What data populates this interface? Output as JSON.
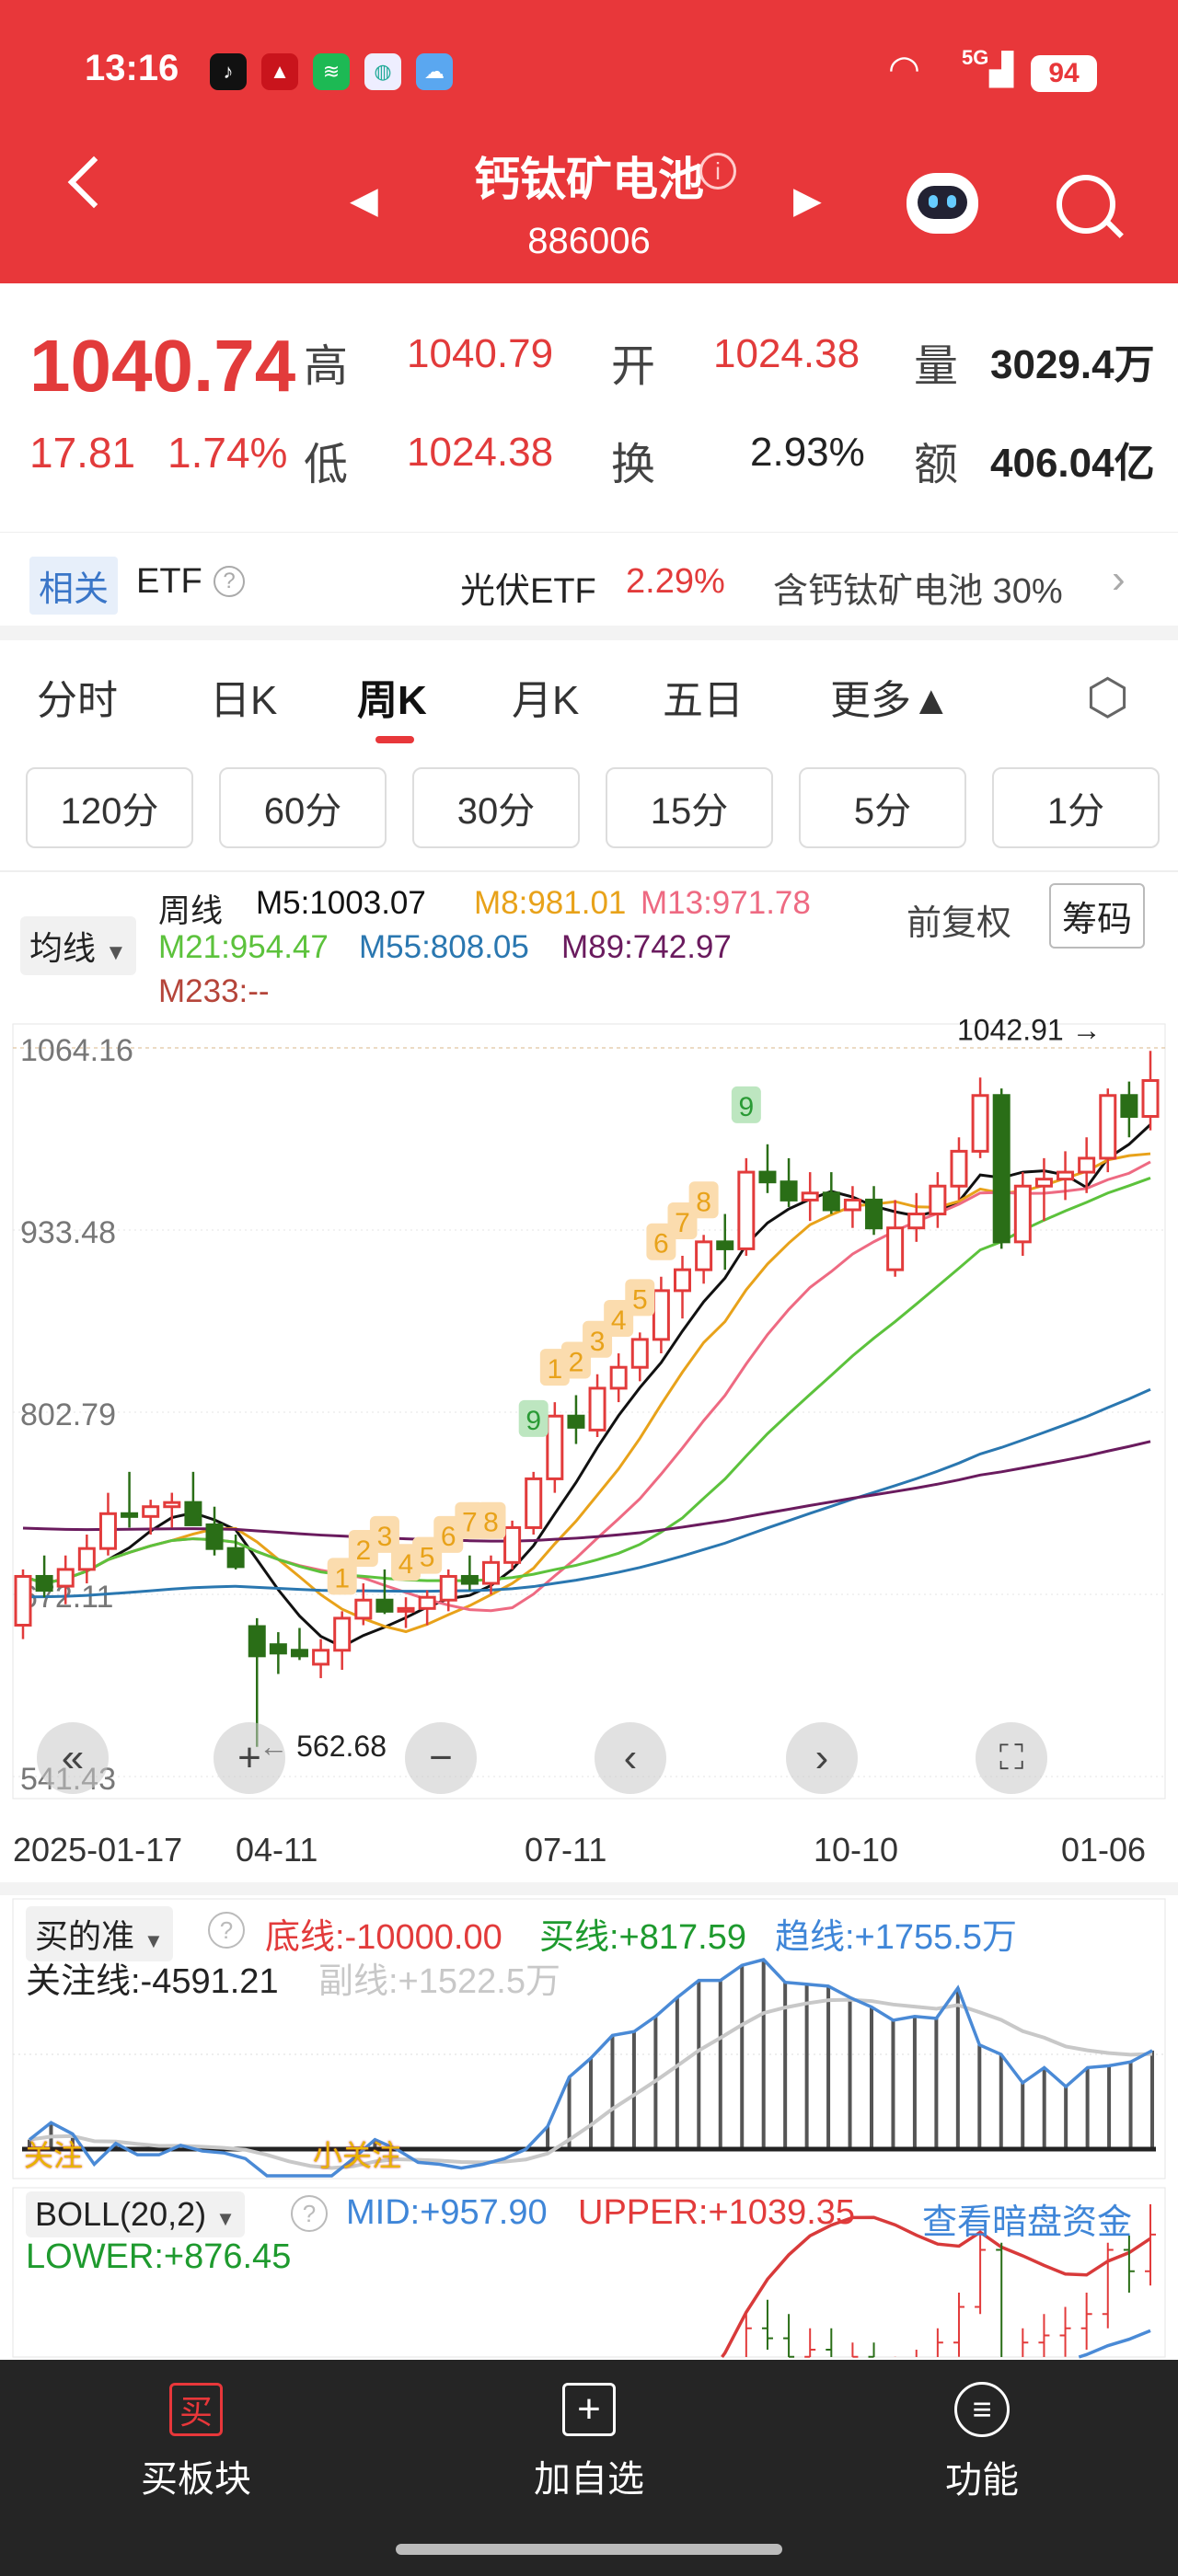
{
  "status_bar": {
    "time": "13:16",
    "network": "5G",
    "battery": "94"
  },
  "header": {
    "title": "钙钛矿电池",
    "code": "886006"
  },
  "quote": {
    "price": "1040.74",
    "change": "17.81",
    "change_pct": "1.74%",
    "high_label": "高",
    "high": "1040.79",
    "open_label": "开",
    "open": "1024.38",
    "volume_label": "量",
    "volume": "3029.4万",
    "low_label": "低",
    "low": "1024.38",
    "turnover_label": "换",
    "turnover": "2.93%",
    "amount_label": "额",
    "amount": "406.04亿"
  },
  "etf_row": {
    "badge": "相关",
    "label": "ETF",
    "etf_name": "光伏ETF",
    "etf_change": "2.29%",
    "holding": "含钙钛矿电池 30%"
  },
  "tabs": [
    {
      "label": "分时"
    },
    {
      "label": "日K"
    },
    {
      "label": "周K",
      "active": true
    },
    {
      "label": "月K"
    },
    {
      "label": "五日"
    },
    {
      "label": "更多▲"
    }
  ],
  "periods": [
    "120分",
    "60分",
    "30分",
    "15分",
    "5分",
    "1分"
  ],
  "legend": {
    "selector": "均线",
    "period": "周线",
    "adjust": "前复权",
    "chips": "筹码",
    "ma": [
      {
        "label": "M5:1003.07",
        "color": "#111111"
      },
      {
        "label": "M8:981.01",
        "color": "#e8a21a"
      },
      {
        "label": "M13:971.78",
        "color": "#ee6a82"
      },
      {
        "label": "M21:954.47",
        "color": "#5cc23c"
      },
      {
        "label": "M55:808.05",
        "color": "#2a77b0"
      },
      {
        "label": "M89:742.97",
        "color": "#6a1b5e"
      },
      {
        "label": "M233:--",
        "color": "#b5453a"
      }
    ]
  },
  "colors": {
    "up": "#e23b3b",
    "down": "#2a6e17",
    "accent": "#e8373a"
  },
  "chart_data": {
    "type": "candlestick",
    "y_ticks": [
      "1064.16",
      "933.48",
      "802.79",
      "672.11",
      "541.43"
    ],
    "y_tick_values": [
      1064.16,
      933.48,
      802.79,
      672.11,
      541.43
    ],
    "ylim": [
      541.43,
      1064.16
    ],
    "x_labels": [
      "2025-01-17",
      "04-11",
      "07-11",
      "10-10",
      "01-06"
    ],
    "max_label": "1042.91",
    "min_label": "562.68",
    "ohlc": [
      [
        650,
        690,
        640,
        685
      ],
      [
        685,
        700,
        670,
        675
      ],
      [
        678,
        700,
        665,
        690
      ],
      [
        690,
        715,
        680,
        705
      ],
      [
        705,
        745,
        700,
        730
      ],
      [
        730,
        760,
        720,
        728
      ],
      [
        728,
        740,
        715,
        735
      ],
      [
        735,
        745,
        720,
        738
      ],
      [
        738,
        760,
        725,
        722
      ],
      [
        722,
        735,
        700,
        705
      ],
      [
        705,
        715,
        690,
        692
      ],
      [
        649,
        655,
        562.68,
        628
      ],
      [
        636,
        645,
        615,
        630
      ],
      [
        632,
        648,
        625,
        628
      ],
      [
        622,
        640,
        612,
        632
      ],
      [
        632,
        660,
        618,
        655
      ],
      [
        655,
        680,
        650,
        668
      ],
      [
        668,
        690,
        658,
        660
      ],
      [
        660,
        670,
        648,
        662
      ],
      [
        662,
        675,
        650,
        670
      ],
      [
        668,
        690,
        660,
        685
      ],
      [
        685,
        700,
        675,
        680
      ],
      [
        680,
        700,
        672,
        695
      ],
      [
        695,
        725,
        690,
        720
      ],
      [
        720,
        760,
        715,
        755
      ],
      [
        755,
        810,
        745,
        800
      ],
      [
        800,
        815,
        780,
        792
      ],
      [
        790,
        830,
        785,
        820
      ],
      [
        820,
        845,
        810,
        835
      ],
      [
        835,
        860,
        825,
        855
      ],
      [
        855,
        900,
        845,
        890
      ],
      [
        890,
        915,
        870,
        905
      ],
      [
        905,
        930,
        895,
        925
      ],
      [
        925,
        945,
        905,
        920
      ],
      [
        920,
        985,
        915,
        975
      ],
      [
        975,
        995,
        960,
        968
      ],
      [
        968,
        985,
        950,
        955
      ],
      [
        955,
        975,
        940,
        960
      ],
      [
        960,
        975,
        945,
        948
      ],
      [
        948,
        965,
        935,
        955
      ],
      [
        955,
        965,
        930,
        935
      ],
      [
        905,
        955,
        900,
        935
      ],
      [
        935,
        960,
        925,
        945
      ],
      [
        945,
        975,
        935,
        965
      ],
      [
        965,
        1000,
        955,
        990
      ],
      [
        990,
        1042.91,
        985,
        1030
      ],
      [
        1030,
        1035,
        920,
        925
      ],
      [
        925,
        975,
        915,
        965
      ],
      [
        965,
        985,
        940,
        970
      ],
      [
        970,
        990,
        955,
        975
      ],
      [
        975,
        1000,
        960,
        985
      ],
      [
        985,
        1035,
        975,
        1030
      ],
      [
        1030,
        1040,
        1000,
        1015
      ],
      [
        1015,
        1062,
        1005,
        1040.74
      ]
    ],
    "td_marks": [
      [
        15,
        "1"
      ],
      [
        16,
        "2"
      ],
      [
        17,
        "3"
      ],
      [
        18,
        "4"
      ],
      [
        19,
        "5"
      ],
      [
        20,
        "6"
      ],
      [
        21,
        "7"
      ],
      [
        22,
        "8"
      ],
      [
        24,
        "9"
      ],
      [
        25,
        "1"
      ],
      [
        26,
        "2"
      ],
      [
        27,
        "3"
      ],
      [
        28,
        "4"
      ],
      [
        29,
        "5"
      ],
      [
        30,
        "6"
      ],
      [
        31,
        "7"
      ],
      [
        32,
        "8"
      ],
      [
        34,
        "9"
      ]
    ],
    "indicator": {
      "name": "买的准",
      "bottom": "底线:-10000.00",
      "buy": "买线:+817.59",
      "trend": "趋线:+1755.5万",
      "watch": "关注线:-4591.21",
      "sub": "副线:+1522.5万",
      "mark1": "关注",
      "mark2": "小关注",
      "values": [
        5,
        14,
        8,
        -8,
        3,
        -3,
        -3,
        2,
        -1,
        -2,
        -5,
        -15,
        -22,
        -20,
        -15,
        -5,
        5,
        0,
        -7,
        -8,
        -10,
        -8,
        -5,
        0,
        12,
        38,
        48,
        60,
        62,
        70,
        80,
        89,
        89,
        97,
        100,
        88,
        87,
        86,
        80,
        75,
        68,
        70,
        69,
        85,
        55,
        50,
        35,
        43,
        33,
        43,
        44,
        46,
        52
      ]
    },
    "boll": {
      "name": "BOLL(20,2)",
      "mid": "MID:+957.90",
      "upper": "UPPER:+1039.35",
      "lower": "LOWER:+876.45",
      "link": "查看暗盘资金"
    }
  },
  "bottom_bar": [
    {
      "icon": "买",
      "label": "买板块"
    },
    {
      "icon": "+",
      "label": "加自选"
    },
    {
      "icon": "≡",
      "label": "功能"
    }
  ]
}
